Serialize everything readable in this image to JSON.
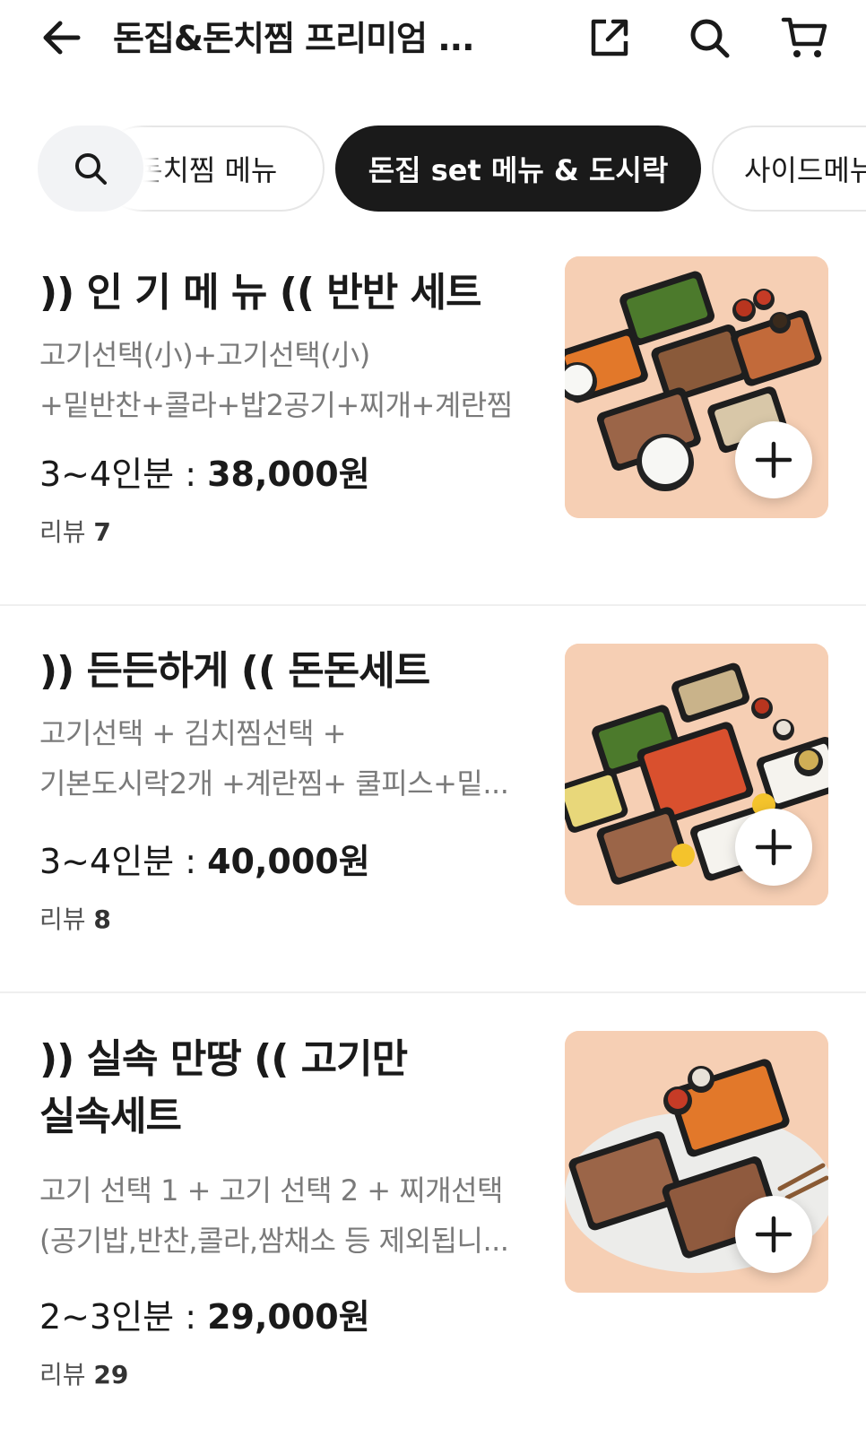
{
  "header": {
    "title": "돈집&돈치찜 프리미엄 ...",
    "back_icon": "arrow-left-icon",
    "share_icon": "share-icon",
    "search_icon": "search-icon",
    "cart_icon": "cart-icon"
  },
  "categories": {
    "search_icon": "search-icon",
    "items": [
      {
        "label": "돈치찜 메뉴",
        "selected": false
      },
      {
        "label": "돈집 set 메뉴 & 도시락",
        "selected": true
      },
      {
        "label": "사이드메뉴",
        "selected": false
      }
    ]
  },
  "menu": [
    {
      "name": ")) 인 기 메 뉴 (( 반반 세트",
      "desc_lines": [
        "고기선택(小)+고기선택(小)",
        "+밑반찬+콜라+밥2공기+찌개+계란찜"
      ],
      "price_label": "3~4인분 : ",
      "price": "38,000원",
      "review_label": "리뷰 ",
      "review_count": "7"
    },
    {
      "name": ")) 든든하게 (( 돈돈세트",
      "desc_lines": [
        "고기선택 + 김치찜선택 +",
        "기본도시락2개 +계란찜+ 쿨피스+밑..."
      ],
      "price_label": "3~4인분 : ",
      "price": "40,000원",
      "review_label": "리뷰 ",
      "review_count": "8"
    },
    {
      "name_lines": [
        ")) 실속 만땅 (( 고기만",
        "실속세트"
      ],
      "desc_lines": [
        "고기 선택 1 + 고기 선택 2 + 찌개선택",
        "(공기밥,반찬,콜라,쌈채소 등 제외됩니..."
      ],
      "price_label": "2~3인분 : ",
      "price": "29,000원",
      "review_label": "리뷰 ",
      "review_count": "29"
    }
  ],
  "colors": {
    "chip_selected_bg": "#1a1a1a",
    "image_bg": "#f7d2b8",
    "muted_text": "#7a7a7a"
  }
}
